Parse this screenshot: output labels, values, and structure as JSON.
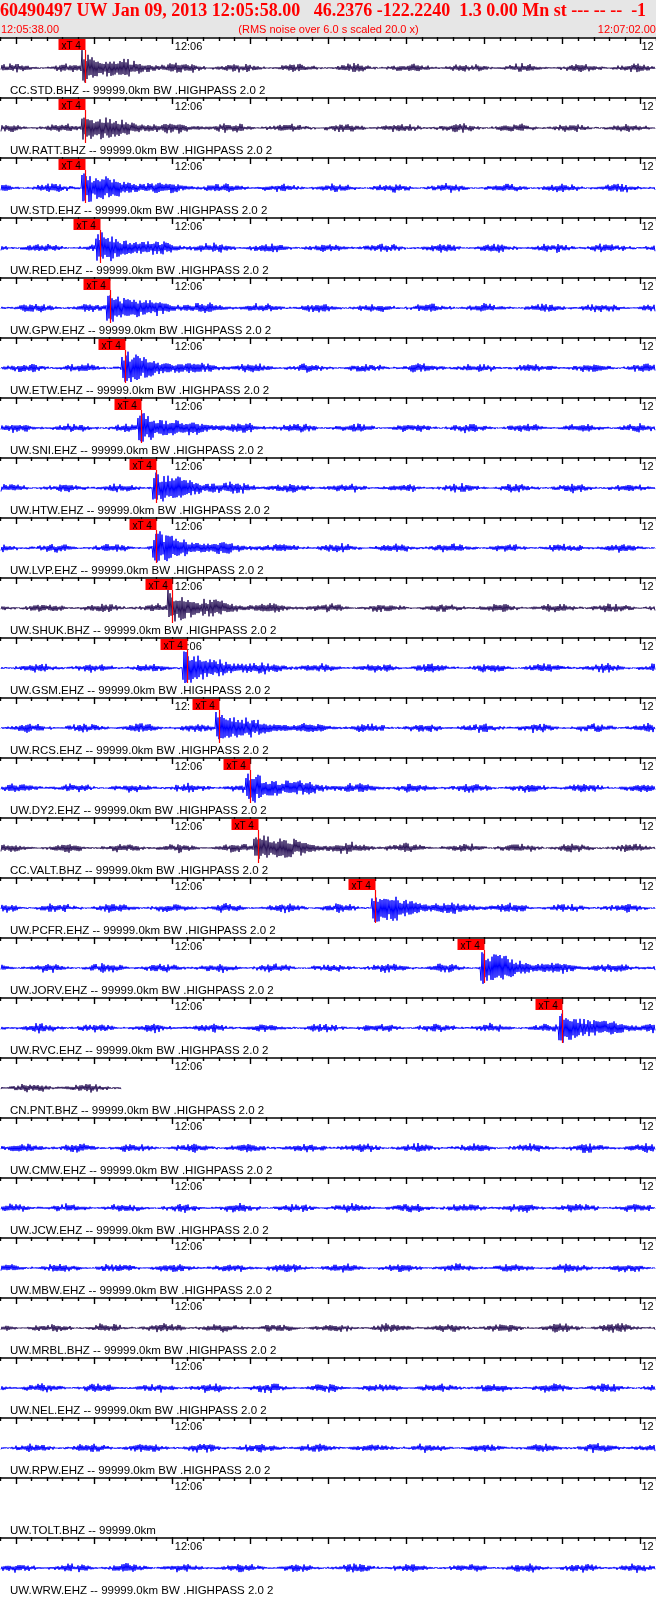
{
  "header": {
    "title": "60490497 UW Jan 09, 2013 12:05:58.00   46.2376 -122.2240  1.3 0.00 Mn st --- -- --  -1",
    "start_time": "12:05:38.00",
    "note": "(RMS noise over 6.0 s scaled 20.0 x)",
    "end_time": "12:07:02.00"
  },
  "channels": [
    {
      "label": "CC.STD.BHZ -- 99999.0km BW .HIGHPASS 2.0 2",
      "color": "#2a1458",
      "kind": "full",
      "pick": {
        "label": "xT 4",
        "level": 0.13
      },
      "time_labels": [
        "12:06",
        "12"
      ]
    },
    {
      "label": "UW.RATT.BHZ -- 99999.0km BW .HIGHPASS 2.0 2",
      "color": "#2a1458",
      "kind": "full",
      "pick": {
        "label": "xT 4",
        "level": 0.13
      },
      "time_labels": [
        "12:06",
        "12"
      ]
    },
    {
      "label": "UW.STD.EHZ -- 99999.0km BW .HIGHPASS 2.0 2",
      "color": "#0000ff",
      "kind": "full",
      "pick": {
        "label": "xT 4",
        "level": 0.13
      },
      "time_labels": [
        "12:06",
        "12"
      ]
    },
    {
      "label": "UW.RED.EHZ -- 99999.0km BW .HIGHPASS 2.0 2",
      "color": "#0000ff",
      "kind": "full",
      "pick": {
        "label": "xT 4",
        "level": 0.152
      },
      "time_labels": [
        "12:06",
        "12"
      ]
    },
    {
      "label": "UW.GPW.EHZ -- 99999.0km BW .HIGHPASS 2.0 2",
      "color": "#0000ff",
      "kind": "full",
      "pick": {
        "label": "xT 4",
        "level": 0.168
      },
      "time_labels": [
        "12:06",
        "12"
      ]
    },
    {
      "label": "UW.ETW.EHZ -- 99999.0km BW .HIGHPASS 2.0 2",
      "color": "#0000ff",
      "kind": "full",
      "pick": {
        "label": "xT 4",
        "level": 0.191
      },
      "time_labels": [
        "12:06",
        "12"
      ]
    },
    {
      "label": "UW.SNI.EHZ -- 99999.0km BW .HIGHPASS 2.0 2",
      "color": "#0000ff",
      "kind": "full",
      "pick": {
        "label": "xT 4",
        "level": 0.215
      },
      "time_labels": [
        "12:06",
        "12"
      ]
    },
    {
      "label": "UW.HTW.EHZ -- 99999.0km BW .HIGHPASS 2.0 2",
      "color": "#0000ff",
      "kind": "full",
      "pick": {
        "label": "xT 4",
        "level": 0.238
      },
      "time_labels": [
        "12:06",
        "12"
      ]
    },
    {
      "label": "UW.LVP.EHZ -- 99999.0km BW .HIGHPASS 2.0 2",
      "color": "#0000ff",
      "kind": "full",
      "pick": {
        "label": "xT 4",
        "level": 0.238
      },
      "time_labels": [
        "12:06",
        "12"
      ]
    },
    {
      "label": "UW.SHUK.BHZ -- 99999.0km BW .HIGHPASS 2.0 2",
      "color": "#2a1458",
      "kind": "full",
      "pick": {
        "label": "xT 4",
        "level": 0.262
      },
      "time_labels": [
        "12:06",
        "12"
      ]
    },
    {
      "label": "UW.GSM.EHZ -- 99999.0km BW .HIGHPASS 2.0 2",
      "color": "#0000ff",
      "kind": "full",
      "pick": {
        "label": "xT 4",
        "level": 0.285
      },
      "time_labels": [
        ":06",
        "12"
      ],
      "time_label_right_aligned": true
    },
    {
      "label": "UW.RCS.EHZ -- 99999.0km BW .HIGHPASS 2.0 2",
      "color": "#0000ff",
      "kind": "full",
      "pick": {
        "label": "xT 4",
        "level": 0.334
      },
      "time_labels": [
        "12:",
        "12"
      ]
    },
    {
      "label": "UW.DY2.EHZ -- 99999.0km BW .HIGHPASS 2.0 2",
      "color": "#0000ff",
      "kind": "full",
      "pick": {
        "label": "xT 4",
        "level": 0.381
      },
      "time_labels": [
        "12:06",
        "12"
      ]
    },
    {
      "label": "CC.VALT.BHZ -- 99999.0km BW .HIGHPASS 2.0 2",
      "color": "#2a1458",
      "kind": "full",
      "pick": {
        "label": "xT 4",
        "level": 0.393
      },
      "time_labels": [
        "12:06",
        "12"
      ]
    },
    {
      "label": "UW.PCFR.EHZ -- 99999.0km BW .HIGHPASS 2.0 2",
      "color": "#0000ff",
      "kind": "full",
      "pick": {
        "label": "xT 4",
        "level": 0.572
      },
      "time_labels": [
        "12:06",
        "12"
      ]
    },
    {
      "label": "UW.JORV.EHZ -- 99999.0km BW .HIGHPASS 2.0 2",
      "color": "#0000ff",
      "kind": "full",
      "pick": {
        "label": "xT 4",
        "level": 0.738
      },
      "time_labels": [
        "12:06",
        "12"
      ]
    },
    {
      "label": "UW.RVC.EHZ -- 99999.0km BW .HIGHPASS 2.0 2",
      "color": "#0000ff",
      "kind": "full",
      "pick": {
        "label": "xT 4",
        "level": 0.857
      },
      "time_labels": [
        "12:06",
        "12"
      ]
    },
    {
      "label": "CN.PNT.BHZ -- 99999.0km BW .HIGHPASS 2.0 2",
      "color": "#2a1458",
      "kind": "partial",
      "time_labels": [
        "12:06",
        "12"
      ]
    },
    {
      "label": "UW.CMW.EHZ -- 99999.0km BW .HIGHPASS 2.0 2",
      "color": "#0000ff",
      "kind": "full",
      "time_labels": [
        "12:06",
        "12"
      ]
    },
    {
      "label": "UW.JCW.EHZ -- 99999.0km BW .HIGHPASS 2.0 2",
      "color": "#0000ff",
      "kind": "full",
      "time_labels": [
        "12:06",
        "12"
      ]
    },
    {
      "label": "UW.MBW.EHZ -- 99999.0km BW .HIGHPASS 2.0 2",
      "color": "#0000ff",
      "kind": "full",
      "time_labels": [
        "12:06",
        "12"
      ]
    },
    {
      "label": "UW.MRBL.BHZ -- 99999.0km BW .HIGHPASS 2.0 2",
      "color": "#2a1458",
      "kind": "full",
      "time_labels": [
        "12:06",
        "12"
      ]
    },
    {
      "label": "UW.NEL.EHZ -- 99999.0km BW .HIGHPASS 2.0 2",
      "color": "#0000ff",
      "kind": "full",
      "time_labels": [
        "12:06",
        "12"
      ]
    },
    {
      "label": "UW.RPW.EHZ -- 99999.0km BW .HIGHPASS 2.0 2",
      "color": "#0000ff",
      "kind": "full",
      "time_labels": [
        "12:06",
        "12"
      ]
    },
    {
      "label": "UW.TOLT.BHZ -- 99999.0km",
      "kind": "none",
      "time_labels": [
        "12:06",
        "12"
      ]
    },
    {
      "label": "UW.WRW.EHZ -- 99999.0km BW .HIGHPASS 2.0 2",
      "color": "#0000ff",
      "kind": "full",
      "time_labels": [
        "12:06",
        "12"
      ]
    }
  ]
}
